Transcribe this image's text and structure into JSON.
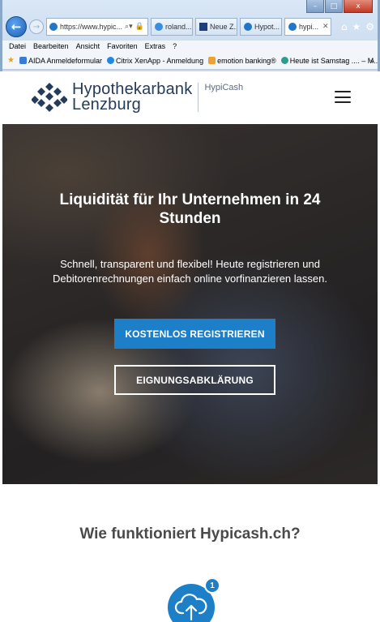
{
  "browser": {
    "address": "https://www.hypic...",
    "tabs": [
      {
        "label": "roland..."
      },
      {
        "label": "Neue Z..."
      },
      {
        "label": "Hypot..."
      },
      {
        "label": "hypi..."
      }
    ],
    "menu": [
      "Datei",
      "Bearbeiten",
      "Ansicht",
      "Favoriten",
      "Extras",
      "?"
    ],
    "favorites": [
      {
        "label": "AIDA Anmeldeformular",
        "color": "#3a7bd5"
      },
      {
        "label": "Citrix XenApp - Anmeldung",
        "color": "#1e88e5"
      },
      {
        "label": "emotion banking®",
        "color": "#f0a030"
      },
      {
        "label": "Heute ist Samstag .... – M...",
        "color": "#2a9d8f"
      }
    ],
    "controls": {
      "minimize": "–",
      "maximize": "□",
      "close": "x"
    },
    "tool_icons": [
      "home-icon",
      "star-icon",
      "gear-icon"
    ]
  },
  "header": {
    "logo_line1": "Hypothekarbank",
    "logo_line2": "Lenzburg",
    "logo_sub": "HypiCash"
  },
  "hero": {
    "title": "Liquidität für Ihr Unternehmen in 24 Stunden",
    "subtitle": "Schnell, transparent und flexibel! Heute registrieren und Debitorenrechnungen einfach online vorfinanzieren lassen.",
    "primary_button": "KOSTENLOS REGISTRIEREN",
    "secondary_button": "EIGNUNGSABKLÄRUNG"
  },
  "how": {
    "title": "Wie funktioniert Hypicash.ch?",
    "step_number": "1"
  },
  "colors": {
    "brand_blue": "#1d7fc8",
    "logo_navy": "#243b5a"
  }
}
